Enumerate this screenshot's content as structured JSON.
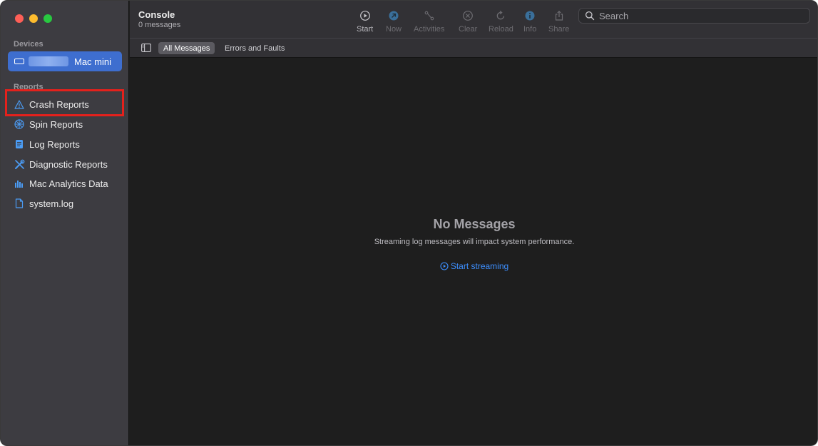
{
  "sidebar": {
    "devices_label": "Devices",
    "device": {
      "name": "Mac mini"
    },
    "reports_label": "Reports",
    "items": [
      {
        "label": "Crash Reports",
        "icon": "warning-triangle-icon"
      },
      {
        "label": "Spin Reports",
        "icon": "spin-wheel-icon"
      },
      {
        "label": "Log Reports",
        "icon": "document-icon"
      },
      {
        "label": "Diagnostic Reports",
        "icon": "wrench-screwdriver-icon"
      },
      {
        "label": "Mac Analytics Data",
        "icon": "bar-chart-icon"
      },
      {
        "label": "system.log",
        "icon": "file-icon"
      }
    ]
  },
  "toolbar": {
    "title": "Console",
    "subtitle": "0 messages",
    "buttons": [
      {
        "label": "Start",
        "icon": "play-circle-icon",
        "enabled": true
      },
      {
        "label": "Now",
        "icon": "now-arrow-icon",
        "enabled": false
      },
      {
        "label": "Activities",
        "icon": "activities-icon",
        "enabled": false
      },
      {
        "label": "Clear",
        "icon": "clear-x-icon",
        "enabled": false
      },
      {
        "label": "Reload",
        "icon": "reload-icon",
        "enabled": false
      },
      {
        "label": "Info",
        "icon": "info-icon",
        "enabled": false
      },
      {
        "label": "Share",
        "icon": "share-icon",
        "enabled": false
      }
    ],
    "search_placeholder": "Search"
  },
  "filterbar": {
    "tabs": [
      {
        "label": "All Messages",
        "active": true
      },
      {
        "label": "Errors and Faults",
        "active": false
      }
    ]
  },
  "content": {
    "empty_title": "No Messages",
    "empty_subtitle": "Streaming log messages will impact system performance.",
    "stream_link": "Start streaming"
  },
  "colors": {
    "accent": "#3e6ecf",
    "link": "#3d8fff",
    "highlight_box": "#e4211c"
  }
}
